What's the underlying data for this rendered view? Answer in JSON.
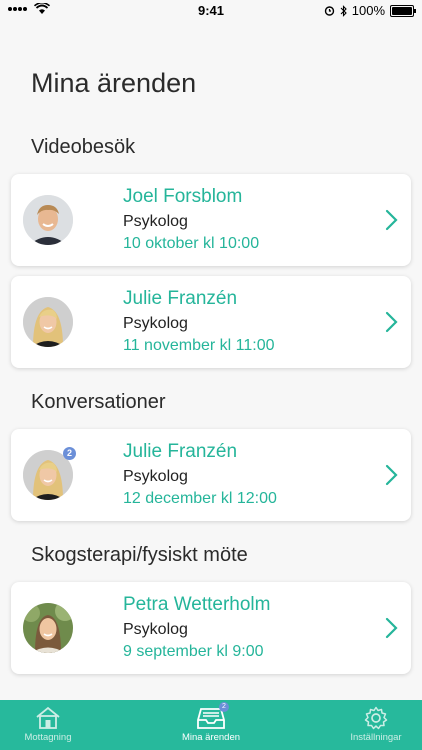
{
  "status_bar": {
    "time": "9:41",
    "battery": "100%",
    "battery_level": 1.0
  },
  "page": {
    "title": "Mina ärenden"
  },
  "sections": [
    {
      "title": "Videobesök"
    },
    {
      "title": "Konversationer"
    },
    {
      "title": "Skogsterapi/fysiskt möte"
    }
  ],
  "cards": [
    {
      "name": "Joel Forsblom",
      "role": "Psykolog",
      "date": "10 oktober kl 10:00",
      "avatar": "man-avatar"
    },
    {
      "name": "Julie Franzén",
      "role": "Psykolog",
      "date": "11 november kl 11:00",
      "avatar": "woman-blonde-avatar"
    },
    {
      "name": "Julie Franzén",
      "role": "Psykolog",
      "date": "12 december kl 12:00",
      "avatar": "woman-blonde-avatar",
      "badge": "2"
    },
    {
      "name": "Petra Wetterholm",
      "role": "Psykolog",
      "date": "9 september kl 9:00",
      "avatar": "woman-forest-avatar"
    }
  ],
  "tabbar": {
    "tabs": [
      {
        "label": "Mottagning",
        "icon": "house-icon",
        "active": false
      },
      {
        "label": "Mina ärenden",
        "icon": "inbox-icon",
        "active": true,
        "badge": "2"
      },
      {
        "label": "Inställningar",
        "icon": "gear-icon",
        "active": false
      }
    ]
  },
  "colors": {
    "accent": "#27b99c",
    "badge": "#6b8fd8",
    "background": "#f7f7f7"
  }
}
